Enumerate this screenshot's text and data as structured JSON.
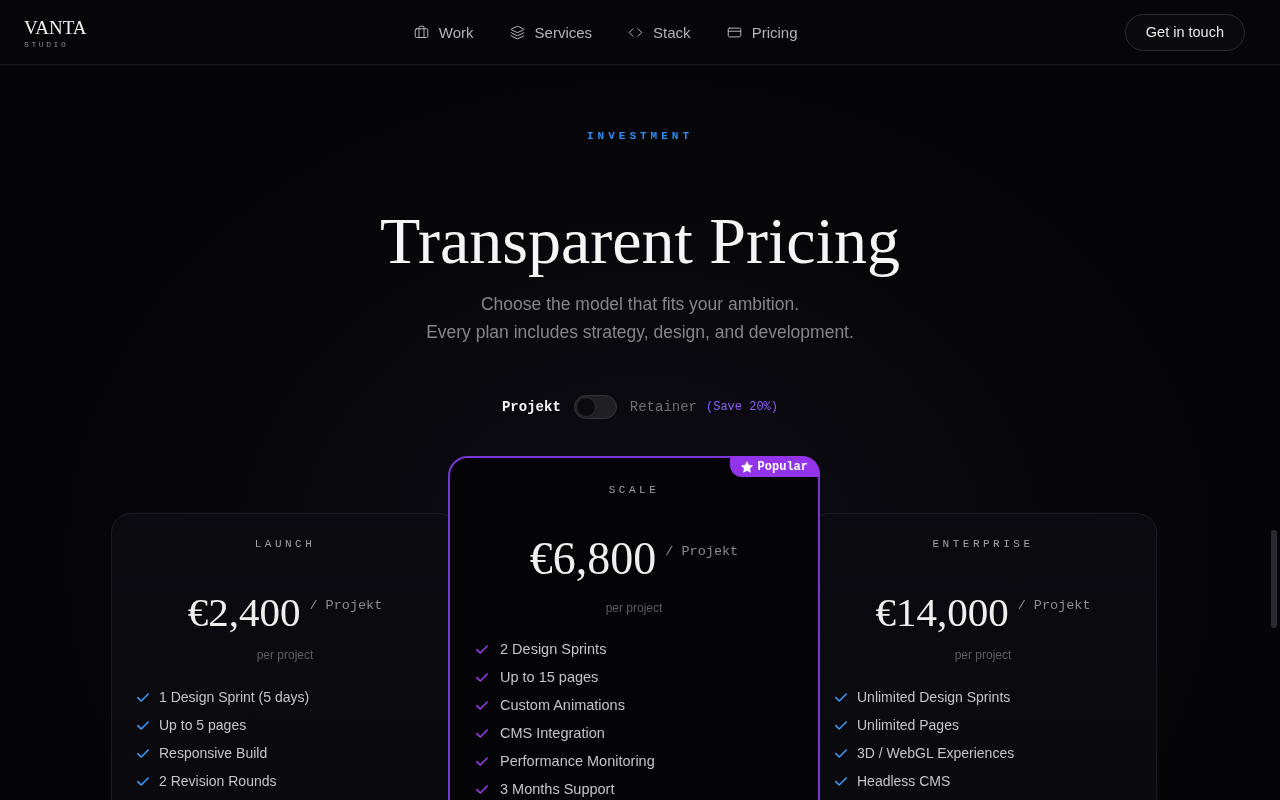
{
  "header": {
    "logo": {
      "name": "VANTA",
      "tagline": "STUDIO"
    },
    "nav": [
      {
        "label": "Work"
      },
      {
        "label": "Services"
      },
      {
        "label": "Stack"
      },
      {
        "label": "Pricing"
      }
    ],
    "cta": "Get in touch"
  },
  "hero": {
    "eyebrow": "INVESTMENT",
    "title": "Transparent Pricing",
    "subtitle": [
      "Choose the model that fits your ambition.",
      "Every plan includes strategy, design, and development."
    ]
  },
  "billing": {
    "options": [
      {
        "label": "Projekt",
        "selected": true
      },
      {
        "label": "Retainer",
        "selected": false
      }
    ],
    "switch": {
      "on": false
    },
    "note": "(Save 20%)"
  },
  "plans": [
    {
      "name": "LAUNCH",
      "featured": false,
      "price": "€2,400",
      "unit": "/ Projekt",
      "caption": "per project",
      "features": [
        "1 Design Sprint (5 days)",
        "Up to 5 pages",
        "Responsive Build",
        "2 Revision Rounds"
      ]
    },
    {
      "name": "SCALE",
      "featured": true,
      "badge": "Popular",
      "price": "€6,800",
      "unit": "/ Projekt",
      "caption": "per project",
      "features": [
        "2 Design Sprints",
        "Up to 15 pages",
        "Custom Animations",
        "CMS Integration",
        "Performance Monitoring",
        "3 Months Support"
      ]
    },
    {
      "name": "ENTERPRISE",
      "featured": false,
      "price": "€14,000",
      "unit": "/ Projekt",
      "caption": "per project",
      "features": [
        "Unlimited Design Sprints",
        "Unlimited Pages",
        "3D / WebGL Experiences",
        "Headless CMS"
      ]
    }
  ]
}
